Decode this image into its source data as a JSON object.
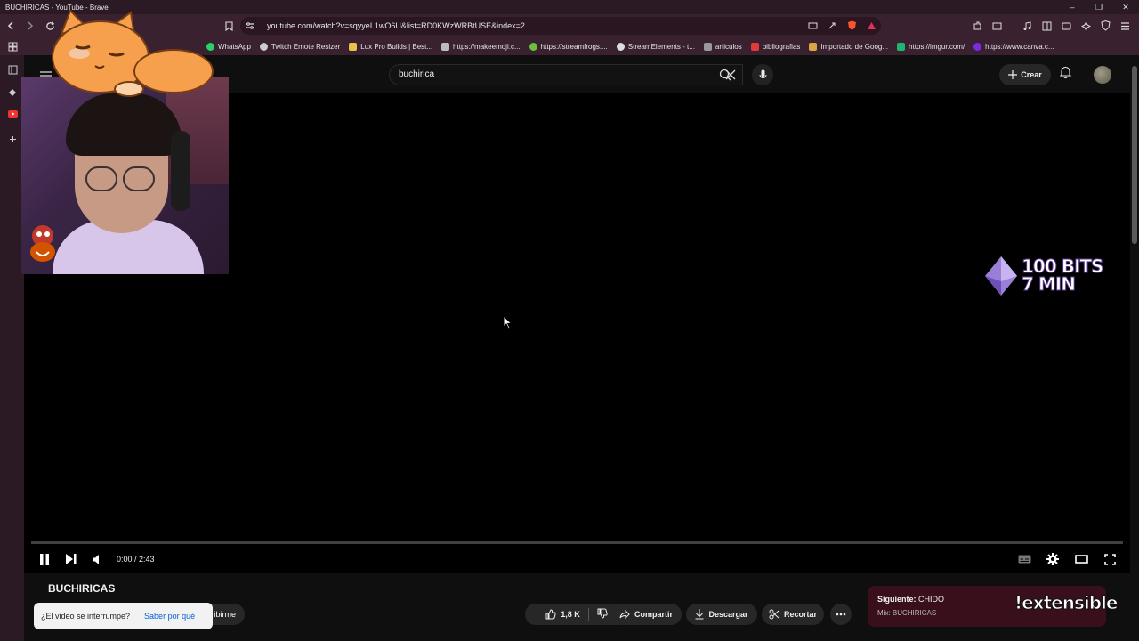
{
  "window": {
    "title": "BUCHIRICAS - YouTube - Brave"
  },
  "address_bar": {
    "url": "youtube.com/watch?v=sqyyeL1wO6U&list=RD0KWzWRBtUSE&index=2"
  },
  "bookmarks": [
    {
      "label": "WhatsApp",
      "color": "#25d366"
    },
    {
      "label": "Twitch Emote Resizer",
      "color": "#cccccc"
    },
    {
      "label": "Lux Pro Builds | Best...",
      "color": "#e6c34a"
    },
    {
      "label": "https://makeemoji.c...",
      "color": "#bbbbbb"
    },
    {
      "label": "https://streamfrogs....",
      "color": "#6bbf3a"
    },
    {
      "label": "StreamElements - t...",
      "color": "#dddddd"
    },
    {
      "label": "articulos",
      "color": "#9a9a9a"
    },
    {
      "label": "bibliografias",
      "color": "#e03a3a"
    },
    {
      "label": "Importado de Goog...",
      "color": "#d9a441"
    },
    {
      "label": "https://imgur.com/",
      "color": "#1bb76e"
    },
    {
      "label": "https://www.canva.c...",
      "color": "#7d2ae8"
    }
  ],
  "youtube": {
    "search_query": "buchirica",
    "create_label": "Crear"
  },
  "player": {
    "time": "0:00 / 2:43",
    "progress": 0.0
  },
  "overlay": {
    "bits_line1": "100 BITS",
    "bits_line2": "7 MIN"
  },
  "video": {
    "title": "BUCHIRICAS",
    "subscribe_partial": "ibirme",
    "likes": "1,8 K",
    "share_label": "Compartir",
    "download_label": "Descargar",
    "clip_label": "Recortar"
  },
  "toast": {
    "message": "¿El video se interrumpe?",
    "link": "Saber por qué"
  },
  "next_up": {
    "label": "Siguiente:",
    "title": "CHIDO",
    "mix": "Mix: BUCHIRICAS"
  },
  "watermark": "!extensible",
  "colors": {
    "accent": "#ff0000",
    "browser_bar": "#3a2130",
    "next_card": "#3a0f1c"
  }
}
